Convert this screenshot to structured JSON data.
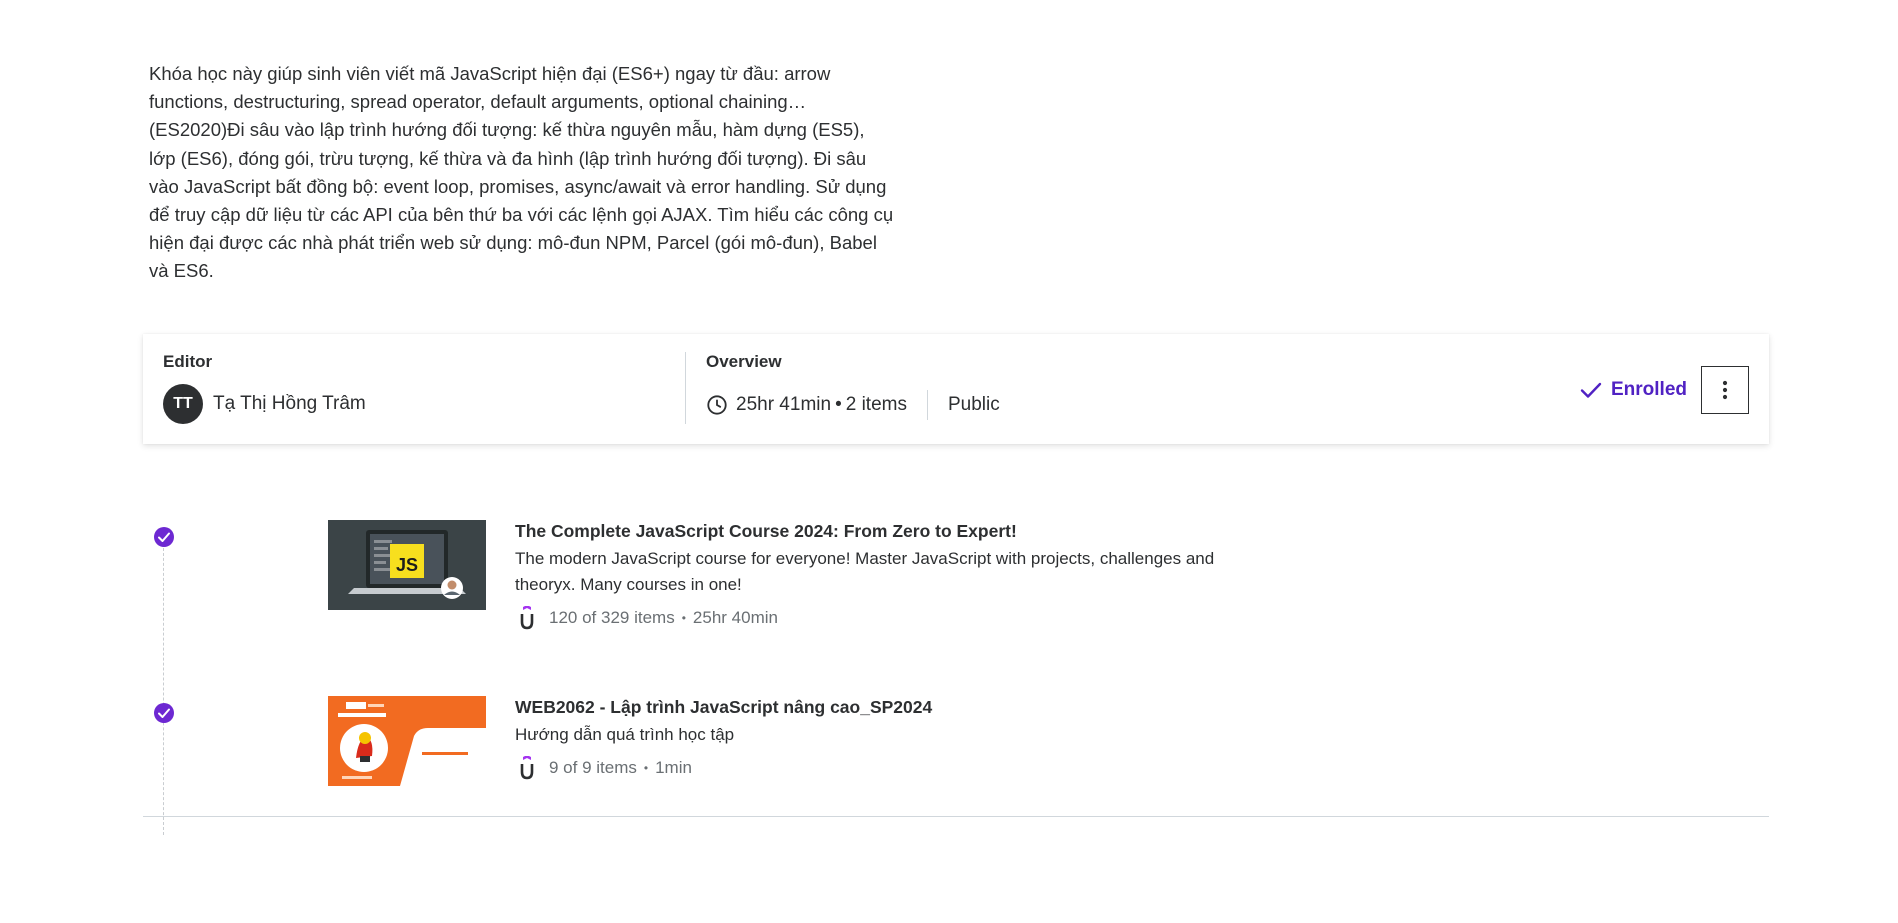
{
  "description": "Khóa học này giúp sinh viên viết mã JavaScript hiện đại (ES6+) ngay từ đầu: arrow functions, destructuring, spread operator, default arguments, optional chaining…(ES2020)Đi sâu vào lập trình hướng đối tượng: kế thừa nguyên mẫu, hàm dựng (ES5), lớp (ES6), đóng gói, trừu tượng, kế thừa và đa hình (lập trình hướng đối tượng). Đi sâu vào JavaScript bất đồng bộ: event loop, promises, async/await và error handling. Sử dụng để truy cập dữ liệu từ các API của bên thứ ba với các lệnh gọi AJAX. Tìm hiểu các công cụ hiện đại được các nhà phát triển web sử dụng: mô-đun NPM, Parcel (gói mô-đun), Babel và ES6.",
  "meta": {
    "editor_label": "Editor",
    "editor_initials": "TT",
    "editor_name": "Tạ Thị Hồng Trâm",
    "overview_label": "Overview",
    "duration": "25hr 41min",
    "dot": "•",
    "items": "2 items",
    "visibility": "Public",
    "enrolled_label": "Enrolled",
    "accent_color": "#5022c3"
  },
  "courses": [
    {
      "title": "The Complete JavaScript Course 2024: From Zero to Expert!",
      "description": "The modern JavaScript course for everyone! Master JavaScript with projects, challenges and theoryx. Many courses in one!",
      "progress": "120 of 329 items",
      "duration": "25hr 40min",
      "thumb_text": "JS",
      "thumb_icon": "laptop-js-thumbnail"
    },
    {
      "title": "WEB2062 - Lập trình JavaScript nâng cao_SP2024",
      "description": "Hướng dẫn quá trình học tập",
      "progress": "9 of 9 items",
      "duration": "1min",
      "thumb_icon": "fpt-polytechnic-thumbnail"
    }
  ],
  "stat_separator": "•",
  "icons": {
    "check": "check-circle-icon",
    "clock": "clock-icon",
    "udemy": "udemy-u-icon",
    "more": "more-vertical-icon"
  }
}
